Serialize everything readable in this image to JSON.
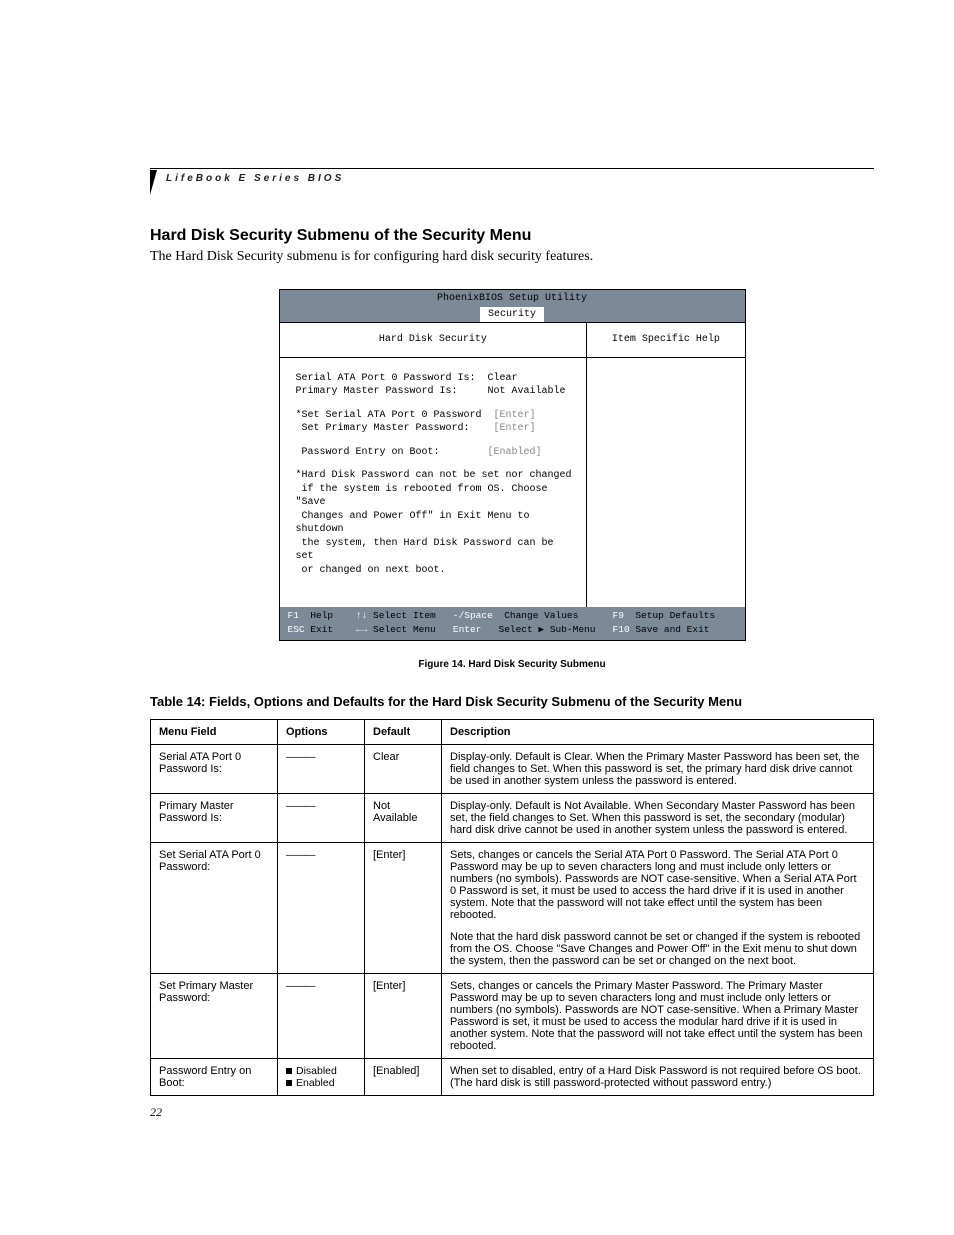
{
  "running_head": "LifeBook E Series BIOS",
  "section_title": "Hard Disk Security Submenu of the Security Menu",
  "intro": "The Hard Disk Security submenu is for configuring hard disk security features.",
  "bios": {
    "title": "PhoenixBIOS Setup Utility",
    "tab": "Security",
    "left_heading": "Hard Disk Security",
    "right_heading": "Item Specific Help",
    "fields": {
      "sata_label": "Serial ATA Port 0 Password Is:",
      "sata_value": "Clear",
      "pm_label": "Primary Master Password Is:",
      "pm_value": "Not Available",
      "set_sata_label": "*Set Serial ATA Port 0 Password",
      "set_sata_value": "[Enter]",
      "set_pm_label": " Set Primary Master Password:",
      "set_pm_value": "[Enter]",
      "boot_label": " Password Entry on Boot:",
      "boot_value": "[Enabled]"
    },
    "note": "*Hard Disk Password can not be set nor changed\n if the system is rebooted from OS. Choose \"Save\n Changes and Power Off\" in Exit Menu to shutdown\n the system, then Hard Disk Password can be set\n or changed on next boot.",
    "footer": {
      "f1": "F1",
      "help": "Help",
      "arrows_v": "↑↓",
      "sel_item": "Select Item",
      "minus": "-/Space",
      "chg": "Change Values",
      "f9": "F9",
      "setup_def": "Setup Defaults",
      "esc": "ESC",
      "exit": "Exit",
      "arrows_h": "←→",
      "sel_menu": "Select Menu",
      "enter": "Enter",
      "sel_sub": "Select ▶ Sub-Menu",
      "f10": "F10",
      "save_exit": "Save and Exit"
    }
  },
  "figure_caption": "Figure 14.   Hard Disk Security Submenu",
  "table_title": "Table 14: Fields, Options and Defaults for the Hard Disk Security Submenu of the Security Menu",
  "table": {
    "headers": {
      "c1": "Menu Field",
      "c2": "Options",
      "c3": "Default",
      "c4": "Description"
    },
    "rows": [
      {
        "field": "Serial ATA Port 0 Password Is:",
        "options_dash": true,
        "default": "Clear",
        "desc": "Display-only. Default is Clear. When the Primary Master Password has been set, the field changes to Set. When this password is set, the primary hard disk drive cannot be used in another system unless the password is entered."
      },
      {
        "field": "Primary Master Password Is:",
        "options_dash": true,
        "default": "Not Available",
        "desc": "Display-only. Default is Not Available. When Secondary Master Password has been set, the field changes to Set. When this password is set, the secondary (modular) hard disk drive cannot be used in another system unless the password is entered."
      },
      {
        "field": "Set Serial ATA Port 0 Password:",
        "options_dash": true,
        "default": "[Enter]",
        "desc": "Sets, changes or cancels the Serial ATA Port 0 Password. The Serial ATA Port 0 Password may be up to seven characters long and must include only letters or numbers (no symbols). Passwords are NOT case-sensitive. When a Serial ATA Port 0 Password is set, it must be used to access the hard drive if it is used in another system. Note that the password will not take effect until the system has been rebooted.",
        "desc2": "Note that the hard disk password cannot be set or changed if the system is rebooted from the OS. Choose \"Save Changes and Power Off\" in the Exit menu to shut down the system, then the password can be set or changed on the next boot."
      },
      {
        "field": "Set Primary Master Password:",
        "options_dash": true,
        "default": "[Enter]",
        "desc": "Sets, changes or cancels the Primary Master Password. The Primary Master Password may be up to seven characters long and must include only letters or numbers (no symbols). Passwords are NOT case-sensitive. When a Primary Master Password is set, it must be used to access the modular hard drive if it is used in another system. Note that the password will not take effect until the system has been rebooted."
      },
      {
        "field": "Password Entry on Boot:",
        "options_list": [
          "Disabled",
          "Enabled"
        ],
        "default": "[Enabled]",
        "desc": "When set to disabled, entry of a Hard Disk Password is not required before OS boot. (The hard disk is still password-protected without password entry.)"
      }
    ]
  },
  "page_number": "22"
}
